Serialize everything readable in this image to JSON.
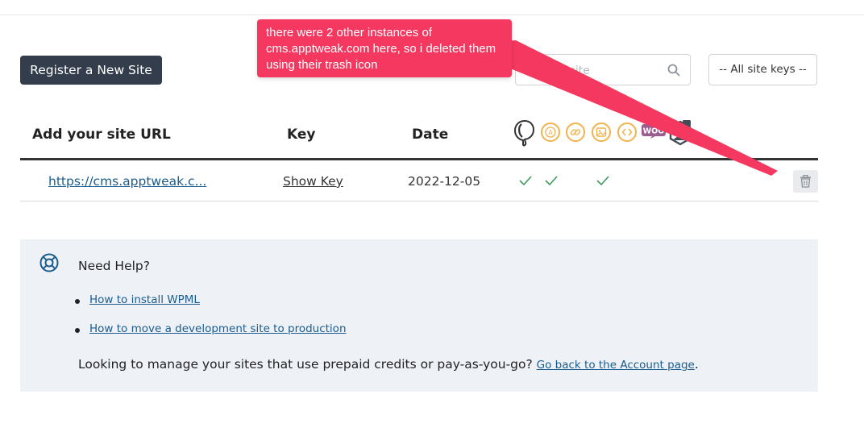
{
  "toolbar": {
    "register_label": "Register a New Site",
    "search_placeholder": "Search site",
    "site_keys_filter": "-- All site keys --"
  },
  "table": {
    "columns": [
      "Add your site URL",
      "Key",
      "Date"
    ],
    "plugin_icons": [
      "wpml-logo-icon",
      "string-translation-icon",
      "link-icon",
      "media-icon",
      "code-icon",
      "woocommerce-icon",
      "translation-management-icon"
    ],
    "woo_label": "WOO",
    "rows": [
      {
        "url": "https://cms.apptweak.c...",
        "key_label": "Show Key",
        "date": "2022-12-05",
        "checks": [
          "wpml-logo-icon",
          "string-translation-icon",
          "media-icon"
        ]
      }
    ]
  },
  "help": {
    "title": "Need Help?",
    "links": [
      "How to install WPML",
      "How to move a development site to production"
    ],
    "footer_text": "Looking to manage your sites that use prepaid credits or pay-as-you-go?",
    "footer_link": "Go back to the Account page",
    "footer_end": "."
  },
  "annotation": {
    "text": "there were 2 other instances of cms.apptweak.com here, so i deleted them using their trash icon",
    "color": "#f5385f"
  },
  "colors": {
    "primary_button": "#333d4c",
    "link": "#1a5c8f",
    "check": "#3d9a5b",
    "plugin_icon_border": "#f0b34e",
    "help_bg": "#eef2f6"
  }
}
